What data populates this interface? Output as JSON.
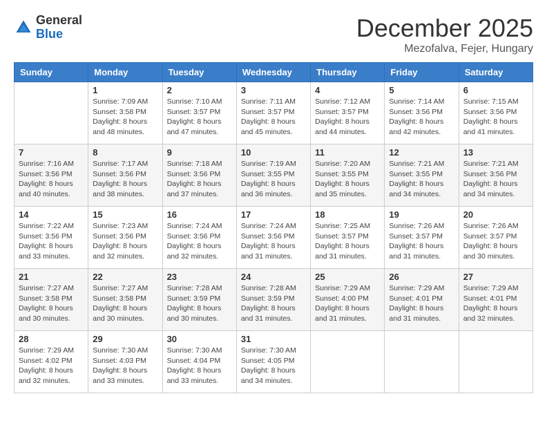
{
  "header": {
    "logo_general": "General",
    "logo_blue": "Blue",
    "month_title": "December 2025",
    "location": "Mezofalva, Fejer, Hungary"
  },
  "days_of_week": [
    "Sunday",
    "Monday",
    "Tuesday",
    "Wednesday",
    "Thursday",
    "Friday",
    "Saturday"
  ],
  "weeks": [
    [
      {
        "day": "",
        "sunrise": "",
        "sunset": "",
        "daylight": ""
      },
      {
        "day": "1",
        "sunrise": "Sunrise: 7:09 AM",
        "sunset": "Sunset: 3:58 PM",
        "daylight": "Daylight: 8 hours and 48 minutes."
      },
      {
        "day": "2",
        "sunrise": "Sunrise: 7:10 AM",
        "sunset": "Sunset: 3:57 PM",
        "daylight": "Daylight: 8 hours and 47 minutes."
      },
      {
        "day": "3",
        "sunrise": "Sunrise: 7:11 AM",
        "sunset": "Sunset: 3:57 PM",
        "daylight": "Daylight: 8 hours and 45 minutes."
      },
      {
        "day": "4",
        "sunrise": "Sunrise: 7:12 AM",
        "sunset": "Sunset: 3:57 PM",
        "daylight": "Daylight: 8 hours and 44 minutes."
      },
      {
        "day": "5",
        "sunrise": "Sunrise: 7:14 AM",
        "sunset": "Sunset: 3:56 PM",
        "daylight": "Daylight: 8 hours and 42 minutes."
      },
      {
        "day": "6",
        "sunrise": "Sunrise: 7:15 AM",
        "sunset": "Sunset: 3:56 PM",
        "daylight": "Daylight: 8 hours and 41 minutes."
      }
    ],
    [
      {
        "day": "7",
        "sunrise": "Sunrise: 7:16 AM",
        "sunset": "Sunset: 3:56 PM",
        "daylight": "Daylight: 8 hours and 40 minutes."
      },
      {
        "day": "8",
        "sunrise": "Sunrise: 7:17 AM",
        "sunset": "Sunset: 3:56 PM",
        "daylight": "Daylight: 8 hours and 38 minutes."
      },
      {
        "day": "9",
        "sunrise": "Sunrise: 7:18 AM",
        "sunset": "Sunset: 3:56 PM",
        "daylight": "Daylight: 8 hours and 37 minutes."
      },
      {
        "day": "10",
        "sunrise": "Sunrise: 7:19 AM",
        "sunset": "Sunset: 3:55 PM",
        "daylight": "Daylight: 8 hours and 36 minutes."
      },
      {
        "day": "11",
        "sunrise": "Sunrise: 7:20 AM",
        "sunset": "Sunset: 3:55 PM",
        "daylight": "Daylight: 8 hours and 35 minutes."
      },
      {
        "day": "12",
        "sunrise": "Sunrise: 7:21 AM",
        "sunset": "Sunset: 3:55 PM",
        "daylight": "Daylight: 8 hours and 34 minutes."
      },
      {
        "day": "13",
        "sunrise": "Sunrise: 7:21 AM",
        "sunset": "Sunset: 3:56 PM",
        "daylight": "Daylight: 8 hours and 34 minutes."
      }
    ],
    [
      {
        "day": "14",
        "sunrise": "Sunrise: 7:22 AM",
        "sunset": "Sunset: 3:56 PM",
        "daylight": "Daylight: 8 hours and 33 minutes."
      },
      {
        "day": "15",
        "sunrise": "Sunrise: 7:23 AM",
        "sunset": "Sunset: 3:56 PM",
        "daylight": "Daylight: 8 hours and 32 minutes."
      },
      {
        "day": "16",
        "sunrise": "Sunrise: 7:24 AM",
        "sunset": "Sunset: 3:56 PM",
        "daylight": "Daylight: 8 hours and 32 minutes."
      },
      {
        "day": "17",
        "sunrise": "Sunrise: 7:24 AM",
        "sunset": "Sunset: 3:56 PM",
        "daylight": "Daylight: 8 hours and 31 minutes."
      },
      {
        "day": "18",
        "sunrise": "Sunrise: 7:25 AM",
        "sunset": "Sunset: 3:57 PM",
        "daylight": "Daylight: 8 hours and 31 minutes."
      },
      {
        "day": "19",
        "sunrise": "Sunrise: 7:26 AM",
        "sunset": "Sunset: 3:57 PM",
        "daylight": "Daylight: 8 hours and 31 minutes."
      },
      {
        "day": "20",
        "sunrise": "Sunrise: 7:26 AM",
        "sunset": "Sunset: 3:57 PM",
        "daylight": "Daylight: 8 hours and 30 minutes."
      }
    ],
    [
      {
        "day": "21",
        "sunrise": "Sunrise: 7:27 AM",
        "sunset": "Sunset: 3:58 PM",
        "daylight": "Daylight: 8 hours and 30 minutes."
      },
      {
        "day": "22",
        "sunrise": "Sunrise: 7:27 AM",
        "sunset": "Sunset: 3:58 PM",
        "daylight": "Daylight: 8 hours and 30 minutes."
      },
      {
        "day": "23",
        "sunrise": "Sunrise: 7:28 AM",
        "sunset": "Sunset: 3:59 PM",
        "daylight": "Daylight: 8 hours and 30 minutes."
      },
      {
        "day": "24",
        "sunrise": "Sunrise: 7:28 AM",
        "sunset": "Sunset: 3:59 PM",
        "daylight": "Daylight: 8 hours and 31 minutes."
      },
      {
        "day": "25",
        "sunrise": "Sunrise: 7:29 AM",
        "sunset": "Sunset: 4:00 PM",
        "daylight": "Daylight: 8 hours and 31 minutes."
      },
      {
        "day": "26",
        "sunrise": "Sunrise: 7:29 AM",
        "sunset": "Sunset: 4:01 PM",
        "daylight": "Daylight: 8 hours and 31 minutes."
      },
      {
        "day": "27",
        "sunrise": "Sunrise: 7:29 AM",
        "sunset": "Sunset: 4:01 PM",
        "daylight": "Daylight: 8 hours and 32 minutes."
      }
    ],
    [
      {
        "day": "28",
        "sunrise": "Sunrise: 7:29 AM",
        "sunset": "Sunset: 4:02 PM",
        "daylight": "Daylight: 8 hours and 32 minutes."
      },
      {
        "day": "29",
        "sunrise": "Sunrise: 7:30 AM",
        "sunset": "Sunset: 4:03 PM",
        "daylight": "Daylight: 8 hours and 33 minutes."
      },
      {
        "day": "30",
        "sunrise": "Sunrise: 7:30 AM",
        "sunset": "Sunset: 4:04 PM",
        "daylight": "Daylight: 8 hours and 33 minutes."
      },
      {
        "day": "31",
        "sunrise": "Sunrise: 7:30 AM",
        "sunset": "Sunset: 4:05 PM",
        "daylight": "Daylight: 8 hours and 34 minutes."
      },
      {
        "day": "",
        "sunrise": "",
        "sunset": "",
        "daylight": ""
      },
      {
        "day": "",
        "sunrise": "",
        "sunset": "",
        "daylight": ""
      },
      {
        "day": "",
        "sunrise": "",
        "sunset": "",
        "daylight": ""
      }
    ]
  ]
}
